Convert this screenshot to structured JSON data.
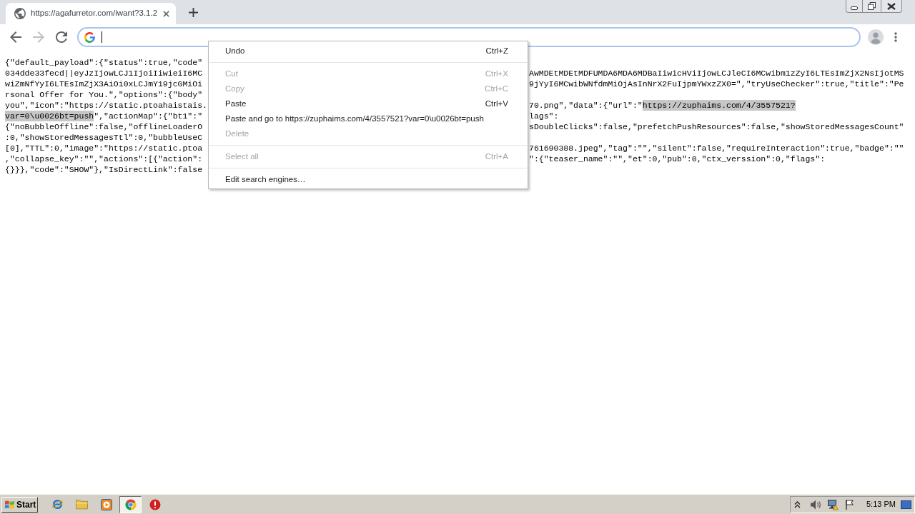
{
  "browser": {
    "tabs": [
      {
        "title": "https://agafurretor.com/iwant?3.1.2",
        "selected": true
      }
    ],
    "toolbar_buttons": [
      {
        "kind": "back",
        "disabled": false
      },
      {
        "kind": "forward",
        "disabled": true
      },
      {
        "kind": "reload",
        "disabled": false
      }
    ],
    "address_bar": {
      "focused": true
    }
  },
  "page": {
    "lines": [
      {
        "left": [
          {
            "text": "{\"default_payload\":{\"status\":true,\"code\"",
            "selected": false
          }
        ]
      },
      {
        "left": [
          {
            "text": "034dde33fecd||eyJzIjowLCJ1IjoiIiwieiI6MC",
            "selected": false
          }
        ],
        "right": [
          {
            "text": "AwMDEtMDEtMDFUMDA6MDA6MDBaIiwicHViIjowLCJleCI6MCwibm1zZyI6LTEsImZjX2NsIjotMS",
            "selected": false
          }
        ]
      },
      {
        "left": [
          {
            "text": "wiZmNfYyI6LTEsImZjX3AiOi0xLCJmY19jcGMiOi",
            "selected": false
          }
        ],
        "right": [
          {
            "text": "9jYyI6MCwibWNfdmMiOjAsInNrX2FuIjpmYWxzZX0=\",\"tryUseChecker\":true,\"title\":\"Pe",
            "selected": false
          }
        ]
      },
      {
        "left": [
          {
            "text": "rsonal Offer for You.\",\"options\":{\"body\"",
            "selected": false
          }
        ]
      },
      {
        "left": [
          {
            "text": "you\",\"icon\":\"https://static.ptoahaistais.",
            "selected": false
          }
        ],
        "right": [
          {
            "text": "70.png\",\"data\":{\"url\":\"",
            "selected": false
          },
          {
            "text": "https://zuphaims.com/4/3557521?",
            "selected": true
          }
        ]
      },
      {
        "left": [
          {
            "text": "var=0\\u0026bt=push",
            "selected": true
          },
          {
            "text": "\",\"actionMap\":{\"bt1\":\"",
            "selected": false
          }
        ],
        "right": [
          {
            "text": "lags\":",
            "selected": false
          }
        ]
      },
      {
        "left": [
          {
            "text": "{\"noBubbleOffline\":false,\"offlineLoaderO",
            "selected": false
          }
        ],
        "right": [
          {
            "text": "sDoubleClicks\":false,\"prefetchPushResources\":false,\"showStoredMessagesCount\"",
            "selected": false
          }
        ]
      },
      {
        "left": [
          {
            "text": ":0,\"showStoredMessagesTtl\":0,\"bubbleUseC",
            "selected": false
          }
        ]
      },
      {
        "left": [
          {
            "text": "[0],\"TTL\":0,\"image\":\"https://static.ptoa",
            "selected": false
          }
        ],
        "right": [
          {
            "text": "761690388.jpeg\",\"tag\":\"\",\"silent\":false,\"requireInteraction\":true,\"badge\":\"\"",
            "selected": false
          }
        ]
      },
      {
        "left": [
          {
            "text": ",\"collapse_key\":\"\",\"actions\":[{\"action\":",
            "selected": false
          }
        ],
        "right": [
          {
            "text": "\":{\"teaser_name\":\"\",\"et\":0,\"pub\":0,\"ctx_verssion\":0,\"flags\":",
            "selected": false
          }
        ]
      },
      {
        "left": [
          {
            "text": "{}}},\"code\":\"SHOW\"},\"IsDirectLink\":false",
            "selected": false
          }
        ]
      }
    ]
  },
  "context_menu": {
    "items": [
      {
        "kind": "item",
        "label": "Undo",
        "shortcut": "Ctrl+Z",
        "disabled": false
      },
      {
        "kind": "separator"
      },
      {
        "kind": "item",
        "label": "Cut",
        "shortcut": "Ctrl+X",
        "disabled": true
      },
      {
        "kind": "item",
        "label": "Copy",
        "shortcut": "Ctrl+C",
        "disabled": true
      },
      {
        "kind": "item",
        "label": "Paste",
        "shortcut": "Ctrl+V",
        "disabled": false
      },
      {
        "kind": "item",
        "label": "Paste and go to https://zuphaims.com/4/3557521?var=0\\u0026bt=push",
        "disabled": false
      },
      {
        "kind": "item",
        "label": "Delete",
        "disabled": true
      },
      {
        "kind": "separator"
      },
      {
        "kind": "item",
        "label": "Select all",
        "shortcut": "Ctrl+A",
        "disabled": true
      },
      {
        "kind": "separator"
      },
      {
        "kind": "item",
        "label": "Edit search engines…",
        "disabled": false
      }
    ]
  },
  "taskbar": {
    "start_label": "Start",
    "apps": [
      {
        "kind": "web",
        "selected": false
      },
      {
        "kind": "folder",
        "selected": false
      },
      {
        "kind": "media",
        "selected": false
      },
      {
        "kind": "browser",
        "selected": true
      },
      {
        "kind": "alert",
        "selected": false
      }
    ],
    "clock": "5:13 PM"
  }
}
